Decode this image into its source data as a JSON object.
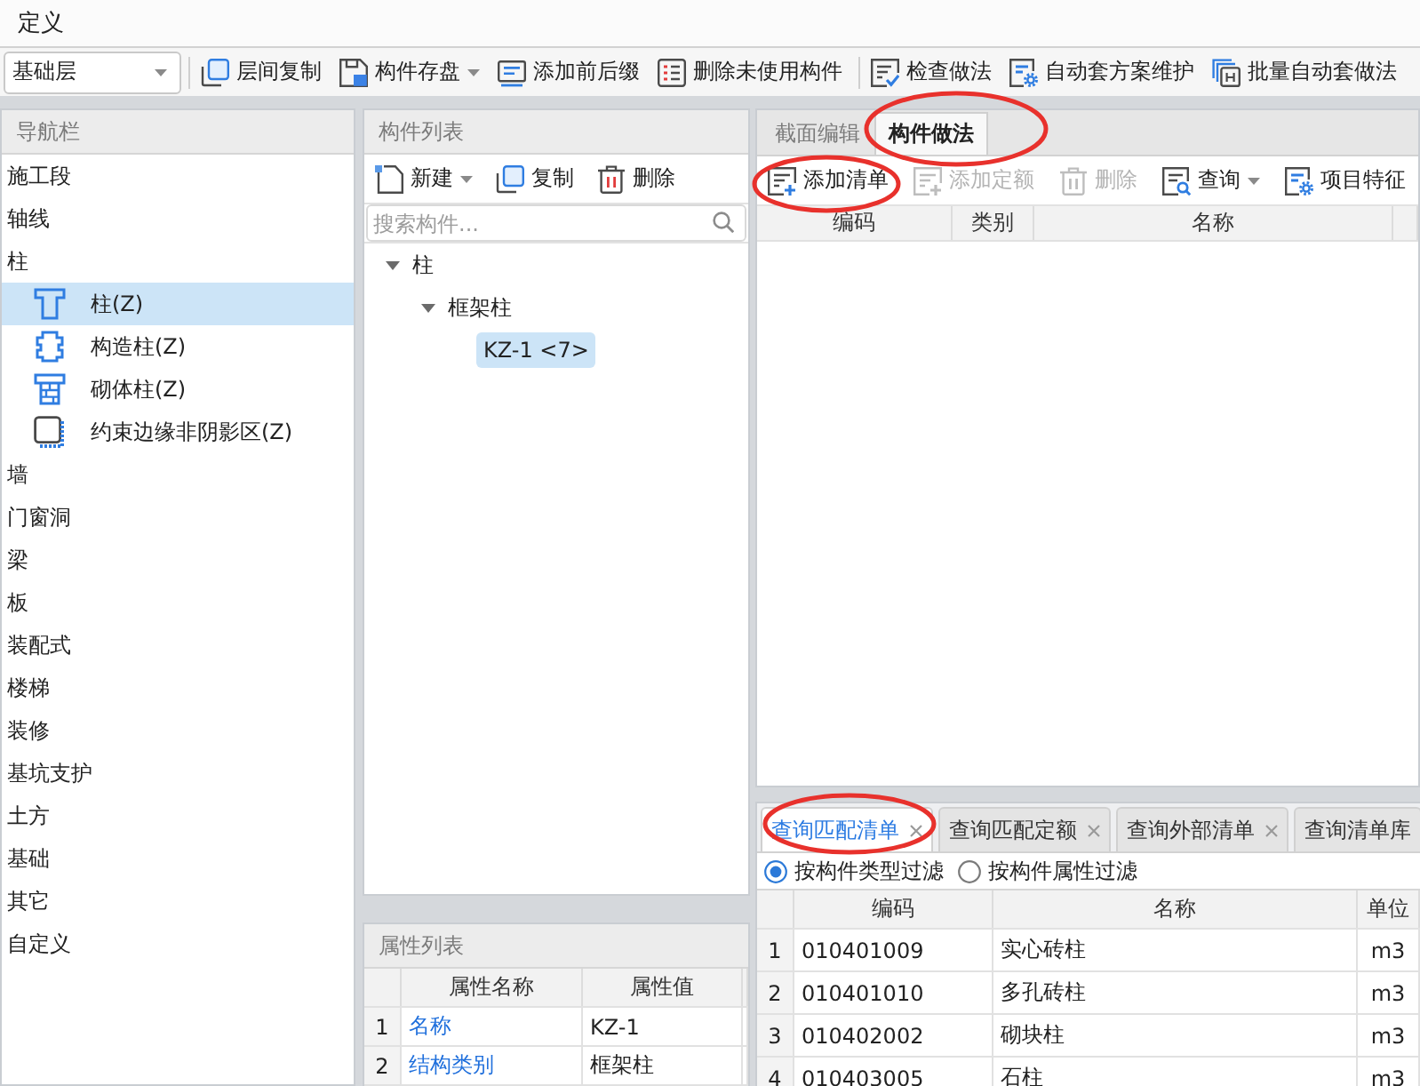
{
  "menu_bar": {
    "items": [
      {
        "label": "定义"
      }
    ]
  },
  "toolbar": {
    "floor_select": {
      "value": "基础层"
    },
    "groups": [
      {
        "buttons": [
          {
            "label": "层间复制",
            "dropdown": false
          },
          {
            "label": "构件存盘",
            "dropdown": true
          },
          {
            "label": "添加前后缀",
            "dropdown": false
          },
          {
            "label": "删除未使用构件",
            "dropdown": false
          }
        ]
      },
      {
        "buttons": [
          {
            "label": "检查做法",
            "dropdown": false
          },
          {
            "label": "自动套方案维护",
            "dropdown": false
          },
          {
            "label": "批量自动套做法",
            "dropdown": false
          }
        ]
      }
    ]
  },
  "navigation": {
    "title": "导航栏",
    "items": [
      {
        "label": "施工段",
        "selected": false
      },
      {
        "label": "轴线",
        "selected": false
      },
      {
        "label": "柱",
        "selected": false,
        "children": [
          {
            "label": "柱(Z)",
            "selected": true
          },
          {
            "label": "构造柱(Z)",
            "selected": false
          },
          {
            "label": "砌体柱(Z)",
            "selected": false
          },
          {
            "label": "约束边缘非阴影区(Z)",
            "selected": false
          }
        ]
      },
      {
        "label": "墙",
        "selected": false
      },
      {
        "label": "门窗洞",
        "selected": false
      },
      {
        "label": "梁",
        "selected": false
      },
      {
        "label": "板",
        "selected": false
      },
      {
        "label": "装配式",
        "selected": false
      },
      {
        "label": "楼梯",
        "selected": false
      },
      {
        "label": "装修",
        "selected": false
      },
      {
        "label": "基坑支护",
        "selected": false
      },
      {
        "label": "土方",
        "selected": false
      },
      {
        "label": "基础",
        "selected": false
      },
      {
        "label": "其它",
        "selected": false
      },
      {
        "label": "自定义",
        "selected": false
      }
    ]
  },
  "component_list": {
    "title": "构件列表",
    "toolbar": [
      {
        "label": "新建",
        "dropdown": true
      },
      {
        "label": "复制",
        "dropdown": false
      },
      {
        "label": "删除",
        "dropdown": false
      }
    ],
    "search": {
      "placeholder": "搜索构件..."
    },
    "tree": [
      {
        "label": "柱",
        "selected": false,
        "expanded": true,
        "children": [
          {
            "label": "框架柱",
            "selected": false,
            "expanded": true,
            "children": [
              {
                "label": "KZ-1 <7>",
                "selected": true
              }
            ]
          }
        ]
      }
    ]
  },
  "properties": {
    "title": "属性列表",
    "columns": [
      "属性名称",
      "属性值"
    ],
    "rows": [
      {
        "number": "1",
        "name": "名称",
        "value": "KZ-1"
      },
      {
        "number": "2",
        "name": "结构类别",
        "value": "框架柱"
      }
    ]
  },
  "method_panel": {
    "tabs": [
      {
        "label": "截面编辑",
        "selected": false,
        "highlighted": false
      },
      {
        "label": "构件做法",
        "selected": true,
        "highlighted": true
      }
    ],
    "toolbar": [
      {
        "label": "添加清单",
        "disabled": false,
        "dropdown": false,
        "highlighted": true
      },
      {
        "label": "添加定额",
        "disabled": true,
        "dropdown": false,
        "highlighted": false
      },
      {
        "label": "删除",
        "disabled": true,
        "dropdown": false,
        "highlighted": false
      },
      {
        "label": "查询",
        "disabled": false,
        "dropdown": true,
        "highlighted": false
      },
      {
        "label": "项目特征",
        "disabled": false,
        "dropdown": false,
        "highlighted": false
      }
    ],
    "table": {
      "columns": [
        "编码",
        "类别",
        "名称"
      ]
    }
  },
  "query_panel": {
    "tabs": [
      {
        "label": "查询匹配清单",
        "selected": true,
        "closable": true,
        "highlighted": true
      },
      {
        "label": "查询匹配定额",
        "selected": false,
        "closable": true,
        "highlighted": false
      },
      {
        "label": "查询外部清单",
        "selected": false,
        "closable": true,
        "highlighted": false
      },
      {
        "label": "查询清单库",
        "selected": false,
        "closable": false,
        "highlighted": false
      }
    ],
    "filters": [
      {
        "label": "按构件类型过滤",
        "selected": true
      },
      {
        "label": "按构件属性过滤",
        "selected": false
      }
    ],
    "table": {
      "columns": [
        "编码",
        "名称",
        "单位"
      ],
      "rows": [
        {
          "number": "1",
          "code": "010401009",
          "name": "实心砖柱",
          "unit": "m3"
        },
        {
          "number": "2",
          "code": "010401010",
          "name": "多孔砖柱",
          "unit": "m3"
        },
        {
          "number": "3",
          "code": "010402002",
          "name": "砌块柱",
          "unit": "m3"
        },
        {
          "number": "4",
          "code": "010403005",
          "name": "石柱",
          "unit": "m3"
        }
      ]
    }
  }
}
